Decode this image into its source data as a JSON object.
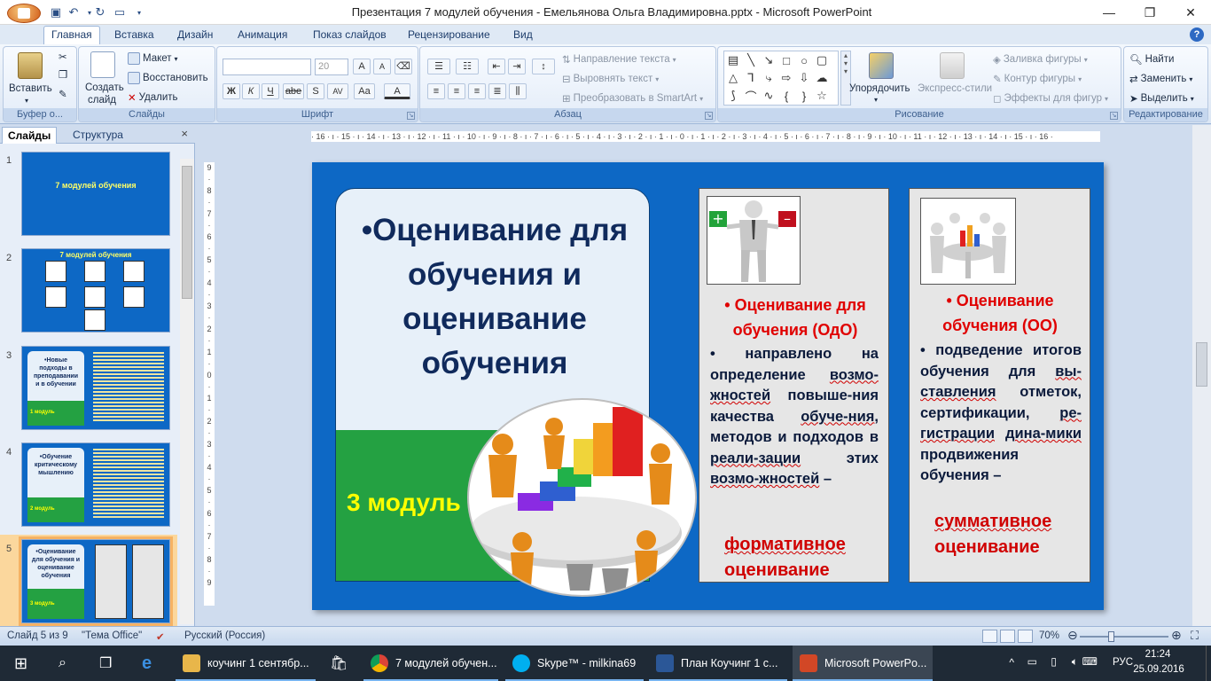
{
  "window": {
    "title": "Презентация 7 модулей обучения - Емельянова Ольга Владимировна.pptx - Microsoft PowerPoint",
    "minimize": "—",
    "restore": "❐",
    "close": "✕"
  },
  "tabs": [
    "Главная",
    "Вставка",
    "Дизайн",
    "Анимация",
    "Показ слайдов",
    "Рецензирование",
    "Вид"
  ],
  "ribbon": {
    "clipboard": {
      "paste": "Вставить",
      "label": "Буфер о..."
    },
    "slides": {
      "create": "Создать",
      "create2": "слайд",
      "layout": "Макет",
      "restore": "Восстановить",
      "delete": "Удалить",
      "label": "Слайды"
    },
    "font": {
      "name": "",
      "size": "20",
      "label": "Шрифт",
      "bold": "Ж",
      "italic": "К",
      "underline": "Ч",
      "strike": "abe",
      "shadow": "S",
      "spacing": "AV",
      "case": "Aa",
      "grow": "A",
      "shrink": "A"
    },
    "paragraph": {
      "direction": "Направление текста",
      "align": "Выровнять текст",
      "smartart": "Преобразовать в SmartArt",
      "label": "Абзац"
    },
    "drawing": {
      "arrange": "Упорядочить",
      "styles": "Экспресс-стили",
      "fill": "Заливка фигуры",
      "outline": "Контур фигуры",
      "effects": "Эффекты для фигур",
      "label": "Рисование"
    },
    "editing": {
      "find": "Найти",
      "replace": "Заменить",
      "select": "Выделить",
      "label": "Редактирование"
    }
  },
  "pane": {
    "tab_slides": "Слайды",
    "tab_outline": "Структура",
    "close": "×"
  },
  "thumbs": [
    {
      "num": "1",
      "title": "7 модулей обучения"
    },
    {
      "num": "2",
      "title": "7 модулей обучения"
    },
    {
      "num": "3",
      "title": "•Новые подходы в преподавании и в обучении",
      "module": "1 модуль"
    },
    {
      "num": "4",
      "title": "•Обучение критическому мышлению",
      "module": "2 модуль"
    },
    {
      "num": "5",
      "title": "•Оценивание для обучения и оценивание обучения",
      "module": "3 модуль"
    }
  ],
  "ruler": {
    "h": "· 16 · ı · 15 · ı · 14 · ı · 13 · ı · 12 · ı · 11 · ı · 10 · ı · 9 · ı · 8 · ı · 7 · ı · 6 · ı · 5 · ı · 4 · ı · 3 · ı · 2 · ı · 1 · ı · 0 · ı · 1 · ı · 2 · ı · 3 · ı · 4 · ı · 5 · ı · 6 · ı · 7 · ı · 8 · ı · 9 · ı · 10 · ı · 11 · ı · 12 · ı · 13 · ı · 14 · ı · 15 · ı · 16 ·",
    "v": [
      "9",
      "·",
      "8",
      "·",
      "7",
      "·",
      "6",
      "·",
      "5",
      "·",
      "4",
      "·",
      "3",
      "·",
      "2",
      "·",
      "1",
      "·",
      "0",
      "·",
      "1",
      "·",
      "2",
      "·",
      "3",
      "·",
      "4",
      "·",
      "5",
      "·",
      "6",
      "·",
      "7",
      "·",
      "8",
      "·",
      "9"
    ]
  },
  "slide": {
    "main_title": "•Оценивание для обучения и оценивание обучения",
    "module": "3 модуль",
    "card1": {
      "title": "• Оценивание для обучения (ОдО)",
      "t1": "• направлено на определение ",
      "t2": "возмо-жностей",
      "t3": " повыше-ния",
      "t4": " качества ",
      "t5": "обуче-ния",
      "t6": ", методов и подходов в ",
      "t7": "реали-зации",
      "t8": " этих ",
      "t9": "возмо-жностей",
      "t10": " –",
      "emph1": "формативное",
      "emph2": "оценивание"
    },
    "card2": {
      "title": "• Оценивание обучения (ОО)",
      "t1": "• подведение итогов обучения для ",
      "t2": "вы-ставления",
      "t3": " отметок, сертификации, ",
      "t4": "ре-гистрации",
      "t5": " ",
      "t6": "дина-мики",
      "t7": " продвижения обучения –",
      "emph1": "суммативное",
      "emph2": "оценивание"
    }
  },
  "status": {
    "slide": "Слайд 5 из 9",
    "theme": "\"Тема Office\"",
    "lang": "Русский (Россия)",
    "zoom": "70%"
  },
  "taskbar": {
    "items": [
      "коучинг 1 сентябр...",
      "7 модулей обучен...",
      "Skype™ - milkina69",
      "План Коучинг  1 с...",
      "Microsoft PowerPo..."
    ],
    "lang": "РУС",
    "time": "21:24",
    "date": "25.09.2016"
  },
  "colors": {
    "slide_bg": "#0d68c5",
    "green": "#24a142",
    "accent_red": "#e00000",
    "title_navy": "#102a5c"
  }
}
